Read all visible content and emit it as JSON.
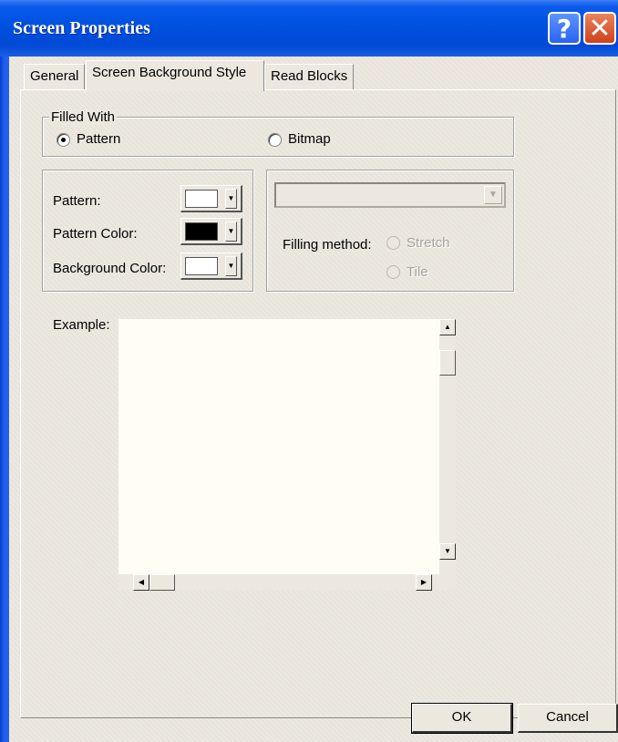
{
  "window": {
    "title": "Screen Properties"
  },
  "title_buttons": {
    "help": "?",
    "close": "✕"
  },
  "tabs": [
    {
      "label": "General",
      "active": false
    },
    {
      "label": "Screen Background Style",
      "active": true
    },
    {
      "label": "Read Blocks",
      "active": false
    }
  ],
  "filled_with": {
    "legend": "Filled With",
    "options": [
      {
        "label": "Pattern",
        "selected": true
      },
      {
        "label": "Bitmap",
        "selected": false
      }
    ]
  },
  "pattern_group": {
    "pattern_label": "Pattern:",
    "pattern_color_label": "Pattern Color:",
    "background_color_label": "Background Color:",
    "pattern_swatch": "#ffffff",
    "pattern_color_swatch": "#000000",
    "background_color_swatch": "#ffffff"
  },
  "bitmap_group": {
    "bitmap_select_value": "",
    "filling_method_label": "Filling method:",
    "stretch_label": "Stretch",
    "tile_label": "Tile"
  },
  "example": {
    "label": "Example:"
  },
  "buttons": {
    "ok": "OK",
    "cancel": "Cancel"
  },
  "colors": {
    "titlebar": "#0052e0",
    "dialog_bg": "#ece8df",
    "preview_bg": "#fffdf4"
  }
}
